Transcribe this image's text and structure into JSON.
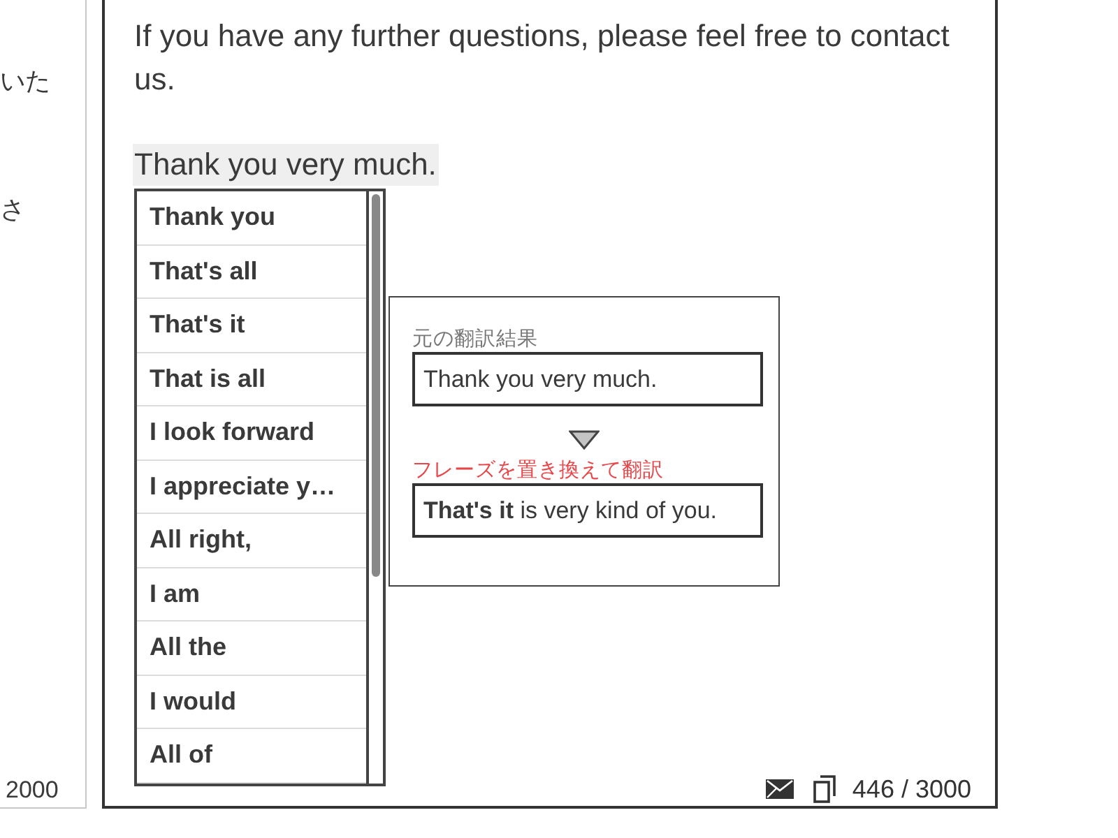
{
  "left_panel": {
    "lines": [
      "いた",
      "さ"
    ],
    "char_count": "2000"
  },
  "editor": {
    "paragraphs": [
      {
        "text": "If you have any further questions, please feel free to contact us.",
        "highlighted": false
      },
      {
        "text": "Thank you very much.",
        "highlighted": true
      }
    ]
  },
  "suggestions": {
    "items": [
      {
        "label": "Thank you",
        "selected": false
      },
      {
        "label": "That's all",
        "selected": false
      },
      {
        "label": "That's it",
        "selected": false
      },
      {
        "label": "That is all",
        "selected": false
      },
      {
        "label": "I look forward",
        "selected": false
      },
      {
        "label": "I appreciate y…",
        "selected": false
      },
      {
        "label": "All right,",
        "selected": false
      },
      {
        "label": "I am",
        "selected": false
      },
      {
        "label": "All the",
        "selected": false
      },
      {
        "label": "I would",
        "selected": false
      },
      {
        "label": "All of",
        "selected": false
      }
    ]
  },
  "preview": {
    "original_label": "元の翻訳結果",
    "original_text": "Thank you very much.",
    "replaced_label": "フレーズを置き換えて翻訳",
    "replaced_text": "**That's it** is very kind of you."
  },
  "footer": {
    "count": "446 / 3000"
  }
}
